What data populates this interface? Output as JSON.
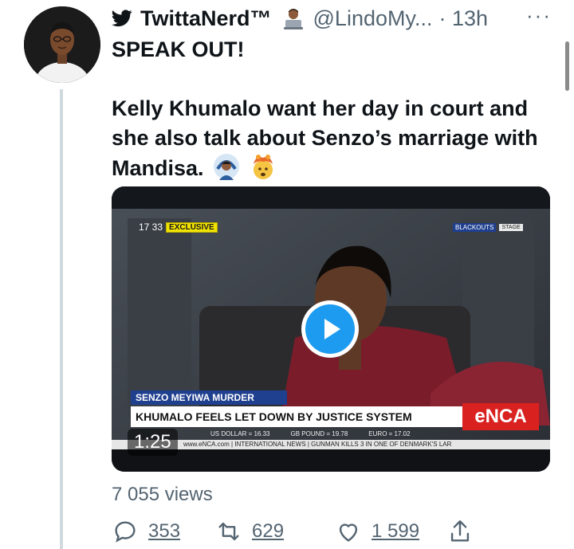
{
  "tweet": {
    "author_name": "TwittaNerd™",
    "handle": "@LindoMy...",
    "time": "· 13h",
    "more_label": "···",
    "headline": "SPEAK OUT!",
    "body": "Kelly Khumalo want her day in court and she also talk about Senzo’s marriage with Mandisa.",
    "body_lines": [
      "Kelly Khumalo want her day in court and",
      "she also talk about Senzo’s marriage with",
      "Mandisa."
    ],
    "inline_emojis": [
      "person-gesturing-emoji",
      "exploding-head-emoji"
    ],
    "badge_emoji": "technologist-emoji",
    "views": "7 055 views"
  },
  "video": {
    "duration": "1:25",
    "time_tag": "17 33",
    "exclusive_tag": "EXCLUSIVE",
    "top_right_tag": "BLACKOUTS",
    "stage_tag": "STAGE",
    "banner_top": "SENZO MEYIWA MURDER",
    "banner_main": "KHUMALO FEELS LET DOWN BY JUSTICE SYSTEM",
    "channel_logo": "eNCA",
    "ticker_rates": [
      "US DOLLAR = 16.33",
      "GB POUND = 19.78",
      "EURO = 17.02"
    ],
    "ticker_text": "www.eNCA.com  |  INTERNATIONAL NEWS  |  GUNMAN KILLS 3 IN ONE OF DENMARK'S LAR"
  },
  "actions": {
    "reply_count": "353",
    "retweet_count": "629",
    "like_count": "1 599"
  },
  "colors": {
    "text": "#0f1419",
    "secondary": "#536471",
    "play_button": "#1d9bf0",
    "banner_blue": "#1f3f8f",
    "exclusive_yellow": "#f2e200",
    "enca_red": "#d9211f"
  }
}
